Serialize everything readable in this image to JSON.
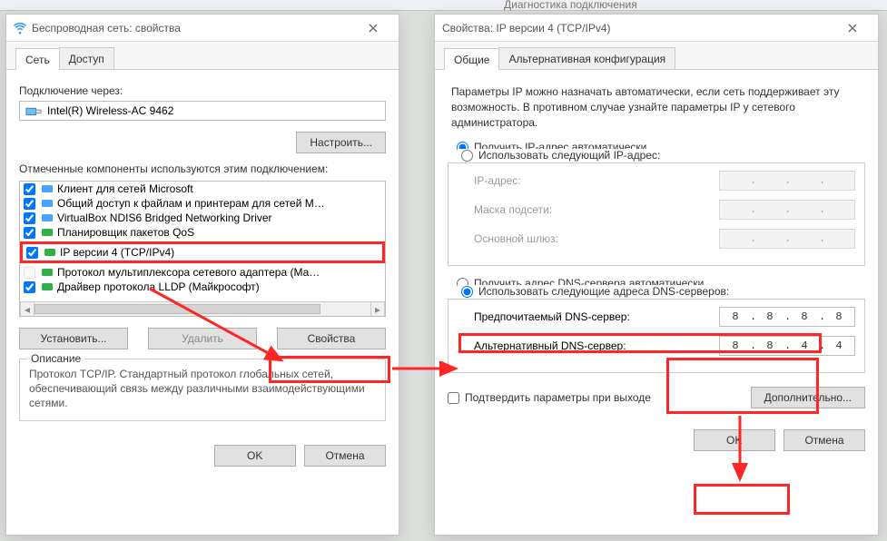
{
  "bg": {
    "diag": "Диагностика подключения"
  },
  "leftWin": {
    "title": "Беспроводная сеть: свойства",
    "tabs": {
      "network": "Сеть",
      "access": "Доступ"
    },
    "connectThrough": "Подключение через:",
    "adapter": "Intel(R) Wireless-AC 9462",
    "configureBtn": "Настроить...",
    "componentsCaption": "Отмеченные компоненты используются этим подключением:",
    "components": [
      {
        "checked": true,
        "iconColor": "#4aa3ff",
        "label": "Клиент для сетей Microsoft"
      },
      {
        "checked": true,
        "iconColor": "#4aa3ff",
        "label": "Общий доступ к файлам и принтерам для сетей M…"
      },
      {
        "checked": true,
        "iconColor": "#4aa3ff",
        "label": "VirtualBox NDIS6 Bridged Networking Driver"
      },
      {
        "checked": true,
        "iconColor": "#31b04a",
        "label": "Планировщик пакетов QoS"
      },
      {
        "checked": true,
        "iconColor": "#31b04a",
        "label": "IP версии 4 (TCP/IPv4)",
        "selected": true
      },
      {
        "checked": false,
        "iconColor": "#31b04a",
        "label": "Протокол мультиплексора сетевого адаптера (Ма…",
        "disabled": true
      },
      {
        "checked": true,
        "iconColor": "#31b04a",
        "label": "Драйвер протокола LLDP (Майкрософт)"
      }
    ],
    "installBtn": "Установить...",
    "removeBtn": "Удалить",
    "propsBtn": "Свойства",
    "descLegend": "Описание",
    "descText": "Протокол TCP/IP. Стандартный протокол глобальных сетей, обеспечивающий связь между различными взаимодействующими сетями.",
    "okBtn": "OK",
    "cancelBtn": "Отмена"
  },
  "rightWin": {
    "title": "Свойства: IP версии 4 (TCP/IPv4)",
    "tabs": {
      "general": "Общие",
      "alt": "Альтернативная конфигурация"
    },
    "intro": "Параметры IP можно назначать автоматически, если сеть поддерживает эту возможность. В противном случае узнайте параметры IP у сетевого администратора.",
    "radioAutoIp": "Получить IP-адрес автоматически",
    "radioManualIp": "Использовать следующий IP-адрес:",
    "ipLabel": "IP-адрес:",
    "maskLabel": "Маска подсети:",
    "gwLabel": "Основной шлюз:",
    "radioAutoDns": "Получить адрес DNS-сервера автоматически",
    "radioManualDns": "Использовать следующие адреса DNS-серверов:",
    "prefDnsLabel": "Предпочитаемый DNS-сервер:",
    "altDnsLabel": "Альтернативный DNS-сервер:",
    "prefDns": [
      "8",
      "8",
      "8",
      "8"
    ],
    "altDns": [
      "8",
      "8",
      "4",
      "4"
    ],
    "confirmOnExit": "Подтвердить параметры при выходе",
    "advancedBtn": "Дополнительно...",
    "okBtn": "OK",
    "cancelBtn": "Отмена"
  }
}
